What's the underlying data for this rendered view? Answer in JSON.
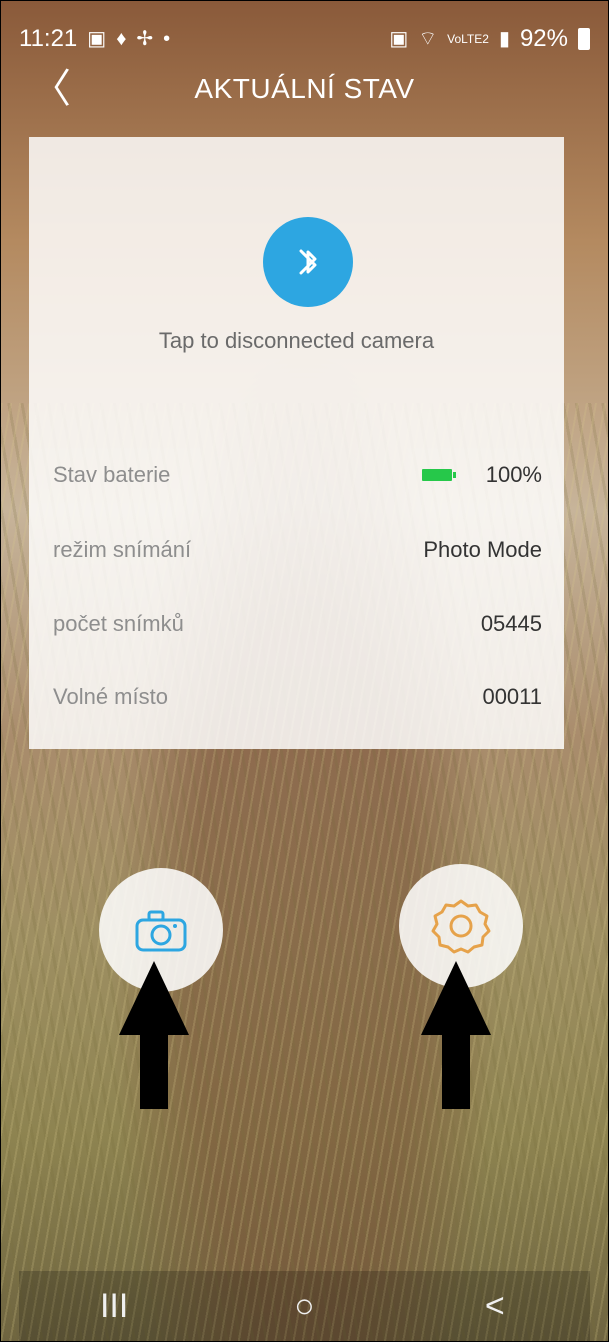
{
  "status": {
    "time": "11:21",
    "left_icons": [
      "gallery-icon",
      "activity-icon",
      "fan-icon",
      "notification-dot"
    ],
    "battery": "92%",
    "network": "VoLTE2"
  },
  "header": {
    "title": "AKTUÁLNÍ STAV"
  },
  "bluetooth": {
    "text": "Tap to disconnected camera",
    "color": "#2da6e1"
  },
  "info": {
    "battery_label": "Stav baterie",
    "battery_value": "100%",
    "mode_label": "režim snímání",
    "mode_value": "Photo Mode",
    "count_label": "počet snímků",
    "count_value": "05445",
    "space_label": "Volné místo",
    "space_value": "00011"
  },
  "actions": {
    "camera_icon": "camera-icon",
    "settings_icon": "gear-icon",
    "camera_color": "#2da6e1",
    "settings_color": "#e6a24a"
  },
  "navbar": {
    "recents": "III",
    "home": "○",
    "back": "<"
  }
}
